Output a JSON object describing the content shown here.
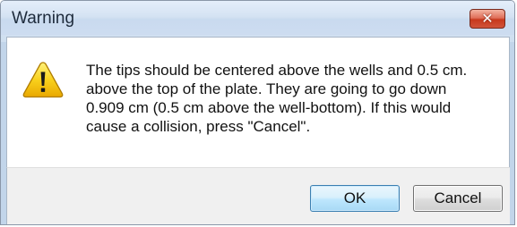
{
  "dialog": {
    "title": "Warning",
    "close_glyph": "✕",
    "icon": "warning-icon",
    "message": "The tips should be centered above the wells and 0.5 cm.\nabove the top of the plate.  They are going to go down\n0.909 cm (0.5 cm above the well-bottom).  If this would\ncause a collision, press \"Cancel\".",
    "buttons": {
      "ok_label": "OK",
      "cancel_label": "Cancel"
    }
  },
  "colors": {
    "warning_yellow": "#f7c600",
    "close_red": "#c7391c",
    "default_button_border": "#3c7fb1"
  }
}
